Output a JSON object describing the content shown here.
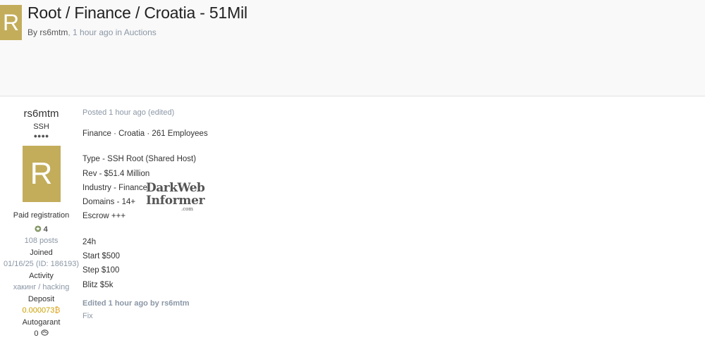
{
  "header": {
    "avatar_letter": "R",
    "title": "Root / Finance / Croatia - 51Mil",
    "by_prefix": "By ",
    "author": "rs6mtm",
    "time_text": ", 1 hour ago in ",
    "forum": "Auctions"
  },
  "author_panel": {
    "name": "rs6mtm",
    "rank": "SSH",
    "rank_pips": "●●●●",
    "avatar_letter": "R",
    "group": "Paid registration",
    "reputation_icon": "rep-icon",
    "reputation": "4",
    "posts": "108 posts",
    "joined_label": "Joined",
    "joined_value": "01/16/25 (ID: 186193)",
    "activity_label": "Activity",
    "activity_value": "хакинг / hacking",
    "deposit_label": "Deposit",
    "deposit_value": "0.000073",
    "deposit_currency": "₿",
    "autogarant_label": "Autogarant",
    "autogarant_value": "0"
  },
  "post": {
    "posted_meta": "Posted 1 hour ago (edited)",
    "summary": "Finance · Croatia · 261 Employees",
    "details": [
      "Type - SSH Root (Shared Host)",
      "Rev - $51.4 Million",
      "Industry - Finance",
      "Domains - 14+",
      "Escrow +++"
    ],
    "auction": [
      "24h",
      "Start $500",
      "Step $100",
      "Blitz $5k"
    ],
    "edited_note": "Edited 1 hour ago by rs6mtm",
    "edit_reason": "Fix"
  },
  "watermark": {
    "line1": "DarkWeb",
    "line2": "Informer",
    "line3": ".com"
  },
  "colors": {
    "avatar": "#c3ad5b",
    "muted": "#8b97a6",
    "deposit": "#c9a000"
  }
}
